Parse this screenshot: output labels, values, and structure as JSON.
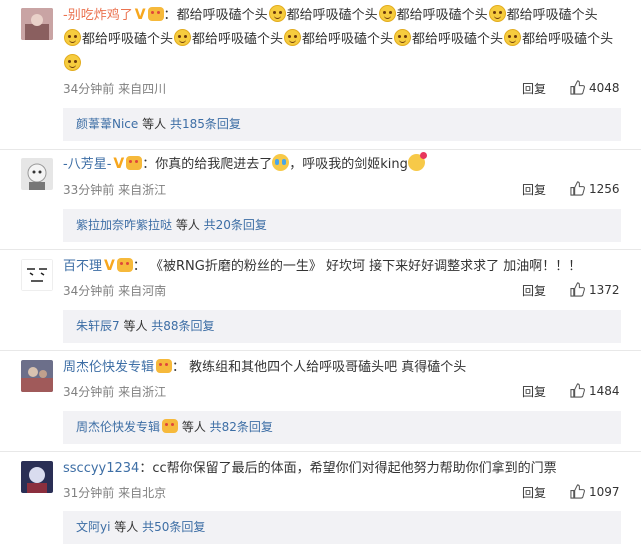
{
  "comments": [
    {
      "name": "-别吃炸鸡了",
      "line1_parts": [
        "都给呼吸磕个头",
        "都给呼吸磕个头",
        "都给呼吸磕个头",
        "都给呼吸磕个头"
      ],
      "line2_parts": [
        "都给呼吸磕个头",
        "都给呼吸磕个头",
        "都给呼吸磕个头",
        "都给呼吸磕个头",
        "都给呼吸磕个头"
      ],
      "time": "34分钟前",
      "source": "来自四川",
      "reply_label": "回复",
      "likes": "4048",
      "sub_user": "颜葦葦Nice",
      "sub_mid": " 等人 ",
      "sub_total": "共185条回复"
    },
    {
      "name": "-八芳星-",
      "text_a": "你真的给我爬进去了",
      "text_b": "，呼吸我的剑姬king",
      "time": "33分钟前",
      "source": "来自浙江",
      "reply_label": "回复",
      "likes": "1256",
      "sub_user": "紫拉加奈咋紫拉哒",
      "sub_mid": " 等人 ",
      "sub_total": "共20条回复"
    },
    {
      "name": "百不理",
      "text": "《被RNG折磨的粉丝的一生》 好坎坷 接下来好好调整求求了 加油啊！！！",
      "time": "34分钟前",
      "source": "来自河南",
      "reply_label": "回复",
      "likes": "1372",
      "sub_user": "朱轩辰7",
      "sub_mid": " 等人 ",
      "sub_total": "共88条回复"
    },
    {
      "name": "周杰伦快发专辑",
      "text": "教练组和其他四个人给呼吸哥磕头吧 真得磕个头",
      "time": "34分钟前",
      "source": "来自浙江",
      "reply_label": "回复",
      "likes": "1484",
      "sub_user": "周杰伦快发专辑",
      "sub_mid": " 等人 ",
      "sub_total": "共82条回复"
    },
    {
      "name": "ssccyy1234",
      "text": "cc帮你保留了最后的体面，希望你们对得起他努力帮助你们拿到的门票",
      "time": "31分钟前",
      "source": "来自北京",
      "reply_label": "回复",
      "likes": "1097",
      "sub_user": "文阿yi",
      "sub_mid": " 等人 ",
      "sub_total": "共50条回复"
    }
  ],
  "colors": {
    "name_orange": "#eb7350",
    "name_blue": "#3d6ea5",
    "meta_gray": "#808080",
    "sub_bg": "#f2f2f5"
  },
  "icons": {
    "like": "thumbs-up-icon",
    "smile": "smile-emoji-icon",
    "vip": "vip-v-icon"
  }
}
